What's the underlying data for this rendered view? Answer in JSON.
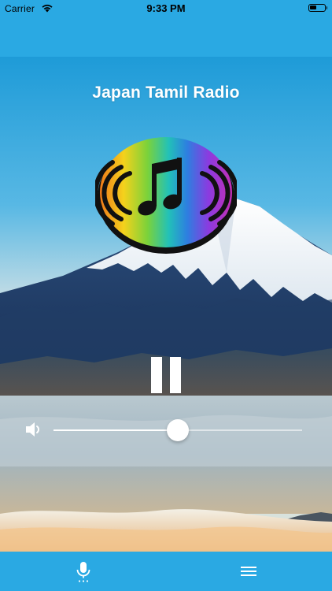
{
  "status_bar": {
    "carrier": "Carrier",
    "time": "9:33 PM",
    "icons": [
      "wifi-icon",
      "battery-icon"
    ]
  },
  "player": {
    "station_name": "Japan Tamil Radio",
    "logo_icon": "music-note-broadcast-icon",
    "playback_state": "playing",
    "control_icon": "pause-icon",
    "volume_fraction": 0.5,
    "volume_icon": "speaker-icon"
  },
  "tab_bar": {
    "items": [
      {
        "icon": "microphone-icon"
      },
      {
        "icon": "hamburger-menu-icon"
      }
    ]
  },
  "colors": {
    "bar_blue": "#2aa9e3",
    "title_text": "#ffffff",
    "control_white": "#ffffff"
  }
}
